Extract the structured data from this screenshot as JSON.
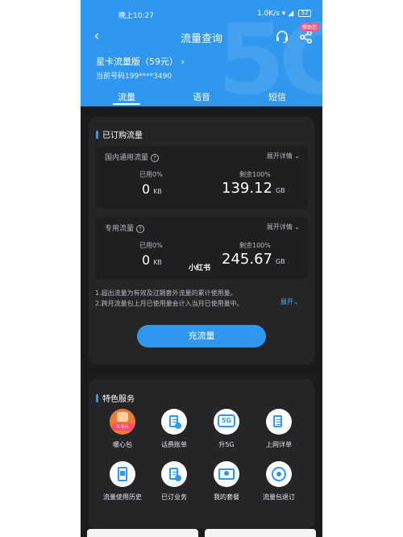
{
  "status": {
    "time": "晚上10:27",
    "network": "1.0K/s",
    "battery": "52"
  },
  "nav": {
    "title": "流量查询",
    "help_badge": "帮助您"
  },
  "plan": {
    "name": "星卡流量版（59元）",
    "chevron": "›",
    "number_label": "当前号码199****3490",
    "background_text": "5G"
  },
  "tabs": [
    {
      "label": "流量"
    },
    {
      "label": "语音"
    },
    {
      "label": "短信"
    }
  ],
  "subscribed": {
    "title": "已订购流量",
    "domestic": {
      "title": "国内通用流量",
      "expand": "展开详情",
      "used_label": "已用0%",
      "used_value": "0",
      "used_unit": "KB",
      "remain_label": "剩余100%",
      "remain_value": "139.12",
      "remain_unit": "GB"
    },
    "dedicated": {
      "title": "专用流量",
      "expand": "展开详情",
      "used_label": "已用0%",
      "used_value": "0",
      "used_unit": "KB",
      "remain_label": "剩余100%",
      "remain_value": "245.67",
      "remain_unit": "GB"
    },
    "notes": [
      "1.超出流量为有效及过期套外流量的累计使用量。",
      "2.跨月流量包上月已使用量会计入当月已使用量中。"
    ],
    "expand_label": "展开",
    "recharge_label": "充流量"
  },
  "watermark": "小红书",
  "features": {
    "title": "特色服务",
    "items": [
      {
        "label": "暖心包",
        "icon": "gift-pack-icon",
        "badge": "9.9元"
      },
      {
        "label": "话费账单",
        "icon": "bill-icon"
      },
      {
        "label": "升5G",
        "icon": "5g-icon",
        "text": "5G"
      },
      {
        "label": "上网详单",
        "icon": "detail-list-icon"
      },
      {
        "label": "流量使用历史",
        "icon": "phone-history-icon"
      },
      {
        "label": "已订业务",
        "icon": "subscribed-icon"
      },
      {
        "label": "我的套餐",
        "icon": "my-plan-icon"
      },
      {
        "label": "流量包退订",
        "icon": "unsubscribe-icon"
      }
    ]
  },
  "colors": {
    "accent": "#2f97ee",
    "background": "#1b1b1d",
    "card": "#252527",
    "inner_card": "#1f1f21"
  }
}
